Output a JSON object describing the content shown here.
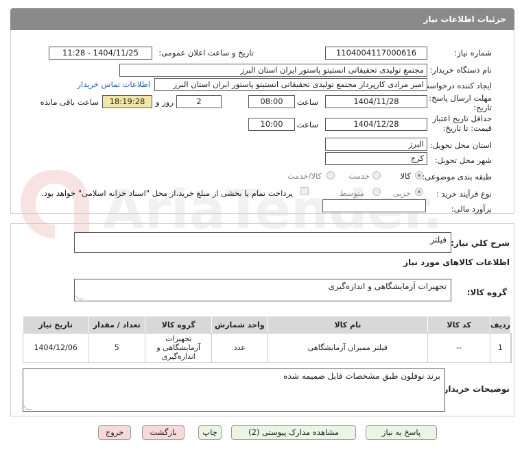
{
  "header": {
    "title": "جزئیات اطلاعات نیاز"
  },
  "watermark": {
    "text": "AriaTender.neT"
  },
  "form": {
    "need_number_label": "شماره نیاز:",
    "need_number": "1104004117000616",
    "announce_label": "تاریخ و ساعت اعلان عمومی:",
    "announce_value": "1404/11/25 - 11:28",
    "buyer_org_label": "نام دستگاه خریدار:",
    "buyer_org": "مجتمع تولیدی تحقیقاتی انستیتو پاستور ایران استان البرز",
    "requester_label": "ایجاد کننده درخواست:",
    "requester": "امیر مرادی کارپرداز مجتمع تولیدی تحقیقاتی انستیتو پاستور ایران استان البرز",
    "contact_link": "اطلاعات تماس خریدار",
    "deadline_label_1": "مهلت ارسال پاسخ: تا",
    "deadline_label_2": "تاریخ:",
    "deadline_date": "1404/11/28",
    "time_label": "ساعت",
    "deadline_time": "08:00",
    "days": "2",
    "days_label": "روز و",
    "remaining_time": "18:19:28",
    "remaining_label": "ساعت باقی مانده",
    "validity_label_1": "حداقل تاریخ اعتبار",
    "validity_label_2": "قیمت: تا تاریخ:",
    "validity_date": "1404/12/28",
    "validity_time": "10:00",
    "province_label": "استان محل تحویل:",
    "province": "البرز",
    "city_label": "شهر محل تحویل:",
    "city": "کرج",
    "category_label": "طبقه بندی موضوعی:",
    "category_options": [
      "کالا",
      "خدمت",
      "کالا/خدمت"
    ],
    "process_label": "نوع فرآیند خرید :",
    "process_options": [
      "جزیی",
      "متوسط"
    ],
    "payment_note": "پرداخت تمام یا بخشی از مبلغ خرید،از محل \"اسناد خزانه اسلامی\" خواهد بود.",
    "estimate_label": "برآورد مالی:",
    "estimate_value": ""
  },
  "details": {
    "summary_label": "شرح کلي نياز:",
    "summary": "فیلتر",
    "goods_info_label": "اطلاعات کالاهای مورد نیاز",
    "goods_group_label": "گروه کالا:",
    "goods_group": "تجهیزات آزمایشگاهی و اندازه‌گیری"
  },
  "table": {
    "headers": [
      "ردیف",
      "کد کالا",
      "نام کالا",
      "واحد شمارش",
      "گروه کالا",
      "تعداد / مقدار",
      "تاریخ نیاز"
    ],
    "rows": [
      {
        "row": "1",
        "code": "--",
        "name": "فیلتر ممبران آزمایشگاهی",
        "unit": "عدد",
        "group": "تجهیزات آزمایشگاهی و اندازه‌گیری",
        "qty": "5",
        "date": "1404/12/06"
      }
    ]
  },
  "notes": {
    "label": "توضیحات خریدار:",
    "text": "برند توفلون طبق مشخصات فایل ضمیمه شده"
  },
  "buttons": {
    "reply": "پاسخ به نیاز",
    "docs": "مشاهده مدارک پیوستی (2)",
    "print": "چاپ",
    "back": "بازگشت",
    "exit": "خروج"
  }
}
